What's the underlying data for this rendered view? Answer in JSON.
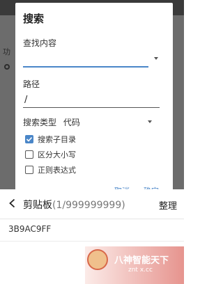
{
  "background": {
    "peek_text": "功"
  },
  "dialog": {
    "title": "搜索",
    "find_label": "查找内容",
    "find_value": "",
    "path_label": "路径",
    "path_value": "/",
    "search_type_label": "搜索类型",
    "search_type_value": "代码",
    "options": [
      {
        "label": "搜索子目录",
        "checked": true
      },
      {
        "label": "区分大小写",
        "checked": false
      },
      {
        "label": "正则表达式",
        "checked": false
      }
    ],
    "cancel_label": "取消",
    "ok_label": "确定"
  },
  "clipboard": {
    "title": "剪贴板",
    "count": "(1/999999999)",
    "organize_label": "整理",
    "items": [
      "3B9AC9FF"
    ]
  },
  "watermark": {
    "text": "八神智能天下",
    "subtext": "znt x.cc"
  },
  "colors": {
    "accent": "#4a86c8",
    "dim_overlay": "#6c6c6c"
  }
}
